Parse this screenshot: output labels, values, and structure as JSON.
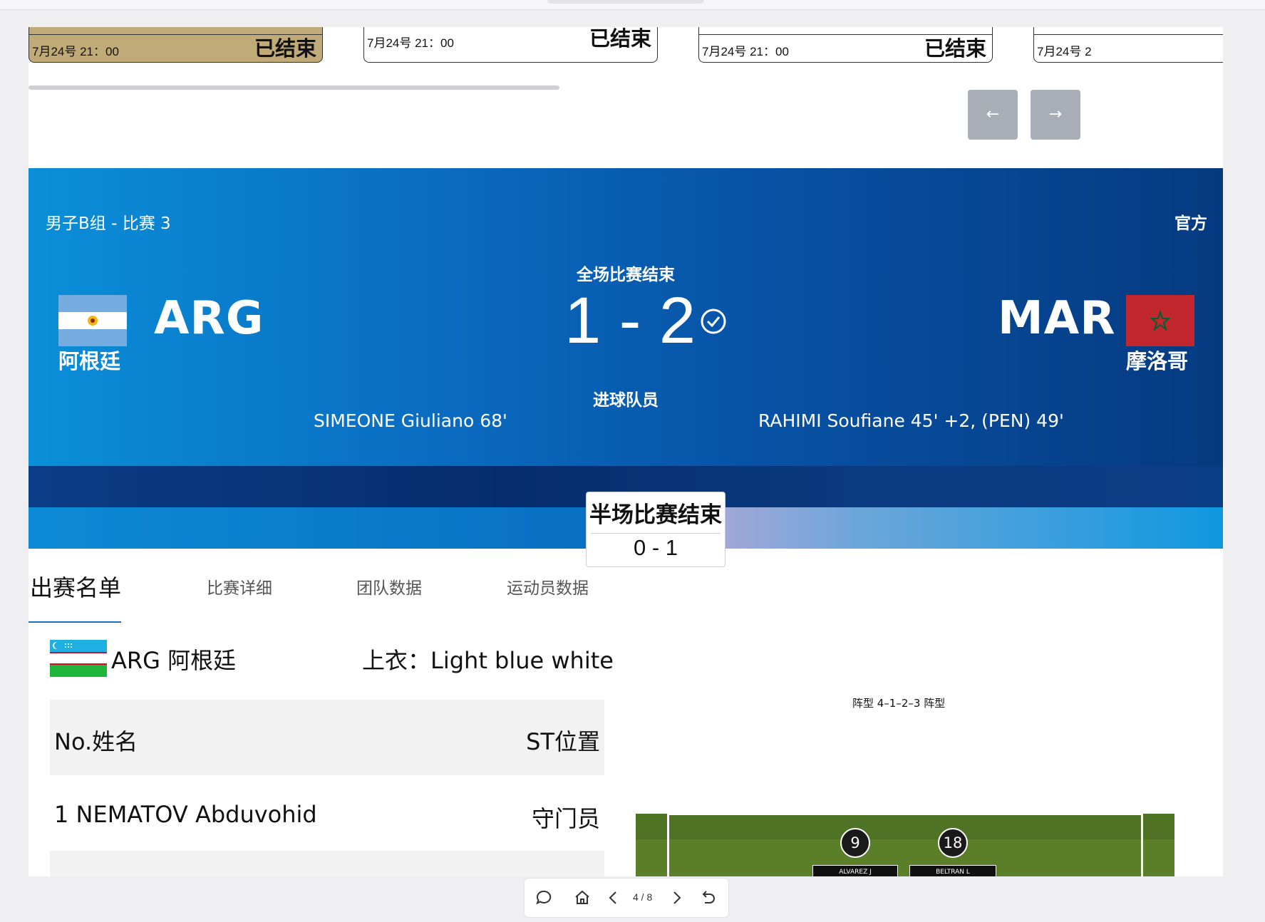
{
  "match_cards": [
    {
      "date": "7月24号 21：00",
      "status": "已结束"
    },
    {
      "date": "7月24号 21：00",
      "status": "已结束"
    },
    {
      "date": "7月24号 21：00",
      "status": "已结束"
    },
    {
      "date": "7月24号 2"
    }
  ],
  "nav": {
    "prev": "←",
    "next": "→"
  },
  "hero": {
    "group": "男子B组 - 比赛 3",
    "official": "官方",
    "status": "全场比赛结束",
    "score": "1 - 2",
    "home": {
      "code": "ARG",
      "name": "阿根廷"
    },
    "away": {
      "code": "MAR",
      "name": "摩洛哥"
    },
    "scorers_title": "进球队员",
    "home_scorers": "SIMEONE Giuliano 68'",
    "away_scorers": "RAHIMI Soufiane 45' +2, (PEN) 49'",
    "halftime_label": "半场比赛结束",
    "halftime_score": "0 - 1"
  },
  "tabs": [
    {
      "label": "出赛名单",
      "active": true
    },
    {
      "label": "比赛详细"
    },
    {
      "label": "团队数据"
    },
    {
      "label": "运动员数据"
    }
  ],
  "roster": {
    "team": "ARG 阿根廷",
    "shirt": "上衣：Light blue white",
    "header_left": "No.姓名",
    "header_right": "ST位置",
    "rows": [
      {
        "name": "1 NEMATOV Abduvohid",
        "position": "守门员"
      }
    ]
  },
  "formation": {
    "label": "阵型 4–1–2–3 阵型",
    "players": [
      {
        "number": "9",
        "name": "ALVAREZ J"
      },
      {
        "number": "18",
        "name": "BELTRAN L"
      }
    ]
  },
  "toolbar": {
    "page": "4 / 8"
  },
  "colors": {
    "hero_blue": "#0a6bc0",
    "card_gold": "#c0ab78",
    "tab_accent": "#1a6fc4"
  }
}
